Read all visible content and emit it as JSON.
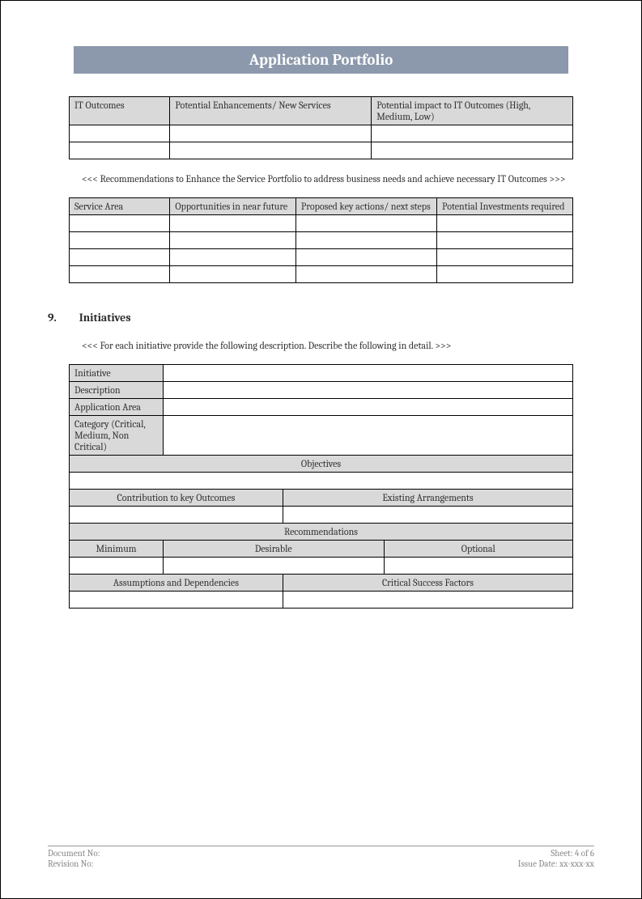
{
  "header": {
    "title": "Application Portfolio"
  },
  "table1": {
    "headers": [
      "IT Outcomes",
      "Potential Enhancements/ New Services",
      "Potential impact to IT Outcomes (High, Medium, Low)"
    ]
  },
  "note1": "<<< Recommendations to Enhance the Service Portfolio to address business needs and achieve necessary IT Outcomes >>>",
  "table2": {
    "headers": [
      "Service Area",
      "Opportunities in near future",
      "Proposed key actions/ next steps",
      "Potential Investments required"
    ]
  },
  "section9": {
    "number": "9.",
    "title": "Initiatives"
  },
  "note2": "<<< For each initiative provide the following description. Describe the following in detail. >>>",
  "table3": {
    "rows": {
      "initiative": "Initiative",
      "description": "Description",
      "app_area": "Application Area",
      "category": "Category (Critical, Medium, Non Critical)"
    },
    "objectives": "Objectives",
    "contrib": "Contribution to key Outcomes",
    "existing": "Existing Arrangements",
    "recommendations": "Recommendations",
    "minimum": "Minimum",
    "desirable": "Desirable",
    "optional": "Optional",
    "assumptions": "Assumptions and Dependencies",
    "csf": "Critical Success Factors"
  },
  "footer": {
    "doc_no": "Document No:",
    "rev_no": "Revision No:",
    "sheet": "Sheet: 4 of 6",
    "issue": "Issue Date: xx-xxx-xx"
  }
}
